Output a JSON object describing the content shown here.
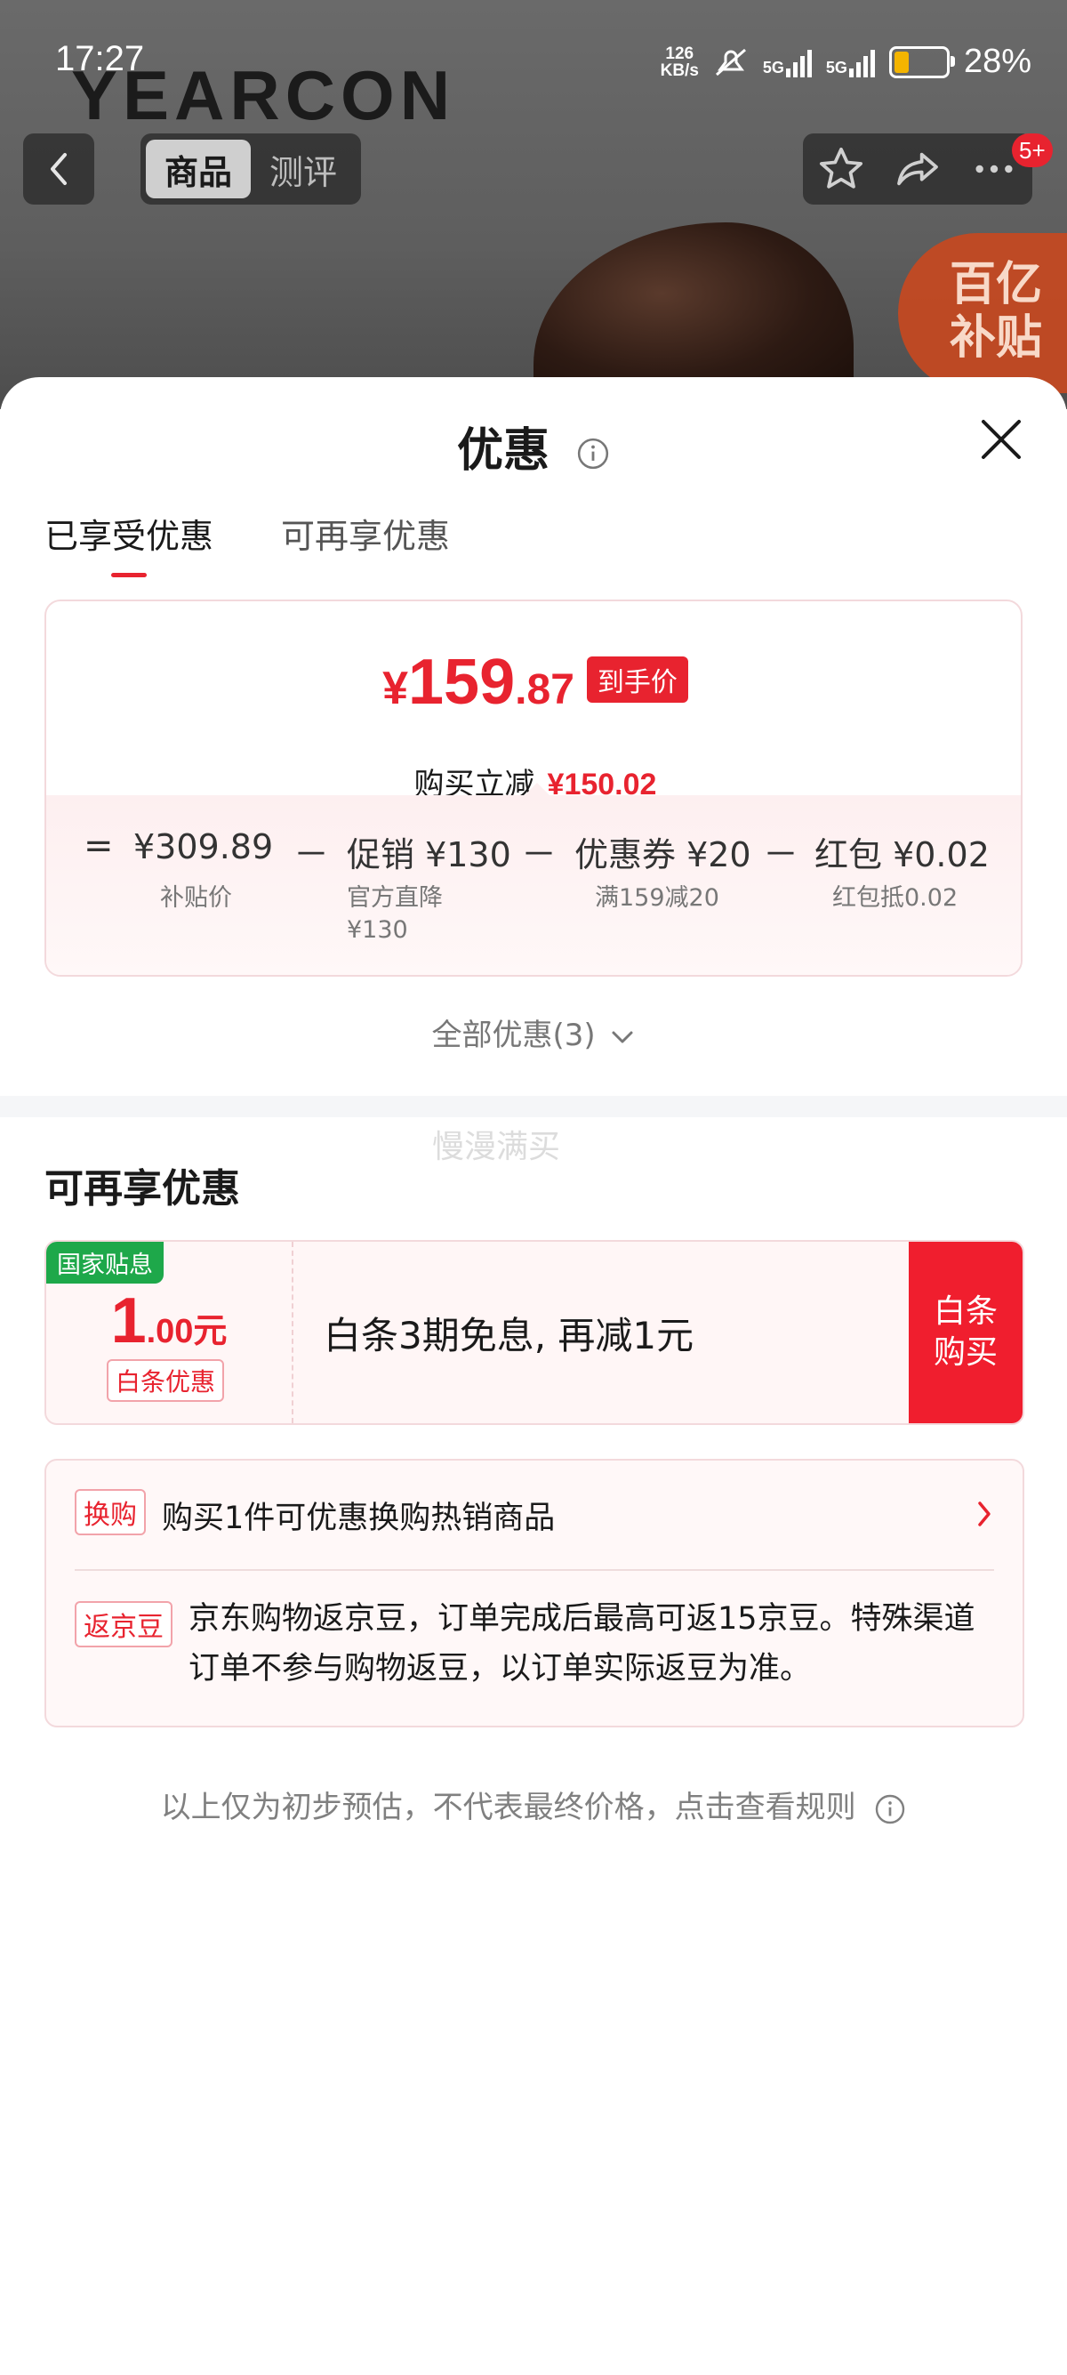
{
  "status_bar": {
    "time": "17:27",
    "net_speed_value": "126",
    "net_speed_unit": "KB/s",
    "network1": "5G",
    "network2": "5G",
    "battery_percent": "28%",
    "battery_level": 0.28
  },
  "product_header": {
    "brand": "YEARCON",
    "subsidy_badge": "百亿补贴",
    "nav_tabs": [
      "商品",
      "测评"
    ],
    "active_tab": 0,
    "more_badge": "5+"
  },
  "sheet": {
    "title": "优惠",
    "tabs": [
      "已享受优惠",
      "可再享优惠"
    ],
    "active_tab": 0
  },
  "summary": {
    "yen": "¥",
    "price_int": "159",
    "price_dec": ".87",
    "price_tag": "到手价",
    "reduce_label": "购买立减",
    "reduce_amount": "¥150.02",
    "breakdown": [
      {
        "op": "=",
        "label": "¥309.89",
        "sub": "补贴价"
      },
      {
        "op": "－",
        "label": "促销 ¥130",
        "sub": "官方直降\n¥130"
      },
      {
        "op": "－",
        "label": "优惠券 ¥20",
        "sub": "满159减20"
      },
      {
        "op": "－",
        "label": "红包 ¥0.02",
        "sub": "红包抵0.02"
      }
    ],
    "all_discounts": "全部优惠(3)"
  },
  "watermark": "慢漫满买",
  "more_section": {
    "title": "可再享优惠",
    "coupon": {
      "flag": "国家贴息",
      "amount_int": "1",
      "amount_dec": ".00元",
      "type": "白条优惠",
      "description": "白条3期免息, 再减1元",
      "button": "白条\n购买"
    },
    "extras": [
      {
        "tag": "换购",
        "text": "购买1件可优惠换购热销商品"
      },
      {
        "tag": "返京豆",
        "text": "京东购物返京豆，订单完成后最高可返15京豆。特殊渠道订单不参与购物返豆，以订单实际返豆为准。"
      }
    ]
  },
  "disclaimer": "以上仅为初步预估，不代表最终价格，点击查看规则",
  "colors": {
    "accent_red": "#e8232f",
    "subsidy_green": "#1ea84a",
    "muted_text": "#777777"
  }
}
